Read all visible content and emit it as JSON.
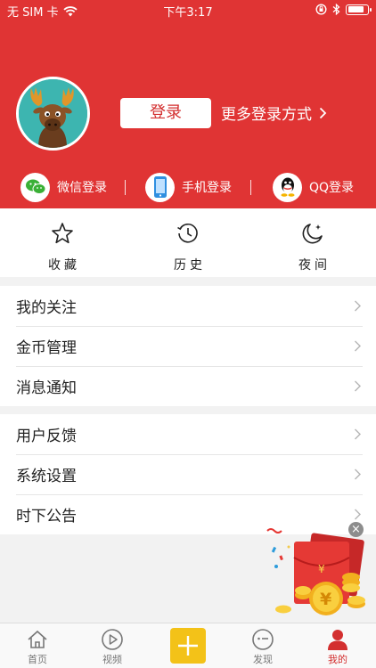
{
  "status_bar": {
    "carrier": "无 SIM 卡",
    "time": "下午3:17",
    "battery_level": 0.85
  },
  "header": {
    "login_label": "登录",
    "more_login_label": "更多登录方式",
    "login_methods": [
      {
        "label": "微信登录",
        "icon": "wechat-icon"
      },
      {
        "label": "手机登录",
        "icon": "phone-icon"
      },
      {
        "label": "QQ登录",
        "icon": "qq-icon"
      }
    ]
  },
  "quick_actions": [
    {
      "label": "收藏",
      "icon": "star-icon"
    },
    {
      "label": "历史",
      "icon": "history-icon"
    },
    {
      "label": "夜间",
      "icon": "moon-icon"
    }
  ],
  "menu_group_1": [
    {
      "label": "我的关注"
    },
    {
      "label": "金币管理"
    },
    {
      "label": "消息通知"
    }
  ],
  "menu_group_2": [
    {
      "label": "用户反馈"
    },
    {
      "label": "系统设置"
    },
    {
      "label": "时下公告"
    }
  ],
  "tab_bar": {
    "tabs": [
      {
        "label": "首页",
        "icon": "home-icon"
      },
      {
        "label": "视频",
        "icon": "play-icon"
      },
      {
        "label": "发现",
        "icon": "discover-icon"
      },
      {
        "label": "我的",
        "icon": "user-icon",
        "active": true
      }
    ]
  },
  "colors": {
    "brand_red": "#e03434",
    "publish_yellow": "#f3c218",
    "avatar_bg": "#3db5b0"
  }
}
